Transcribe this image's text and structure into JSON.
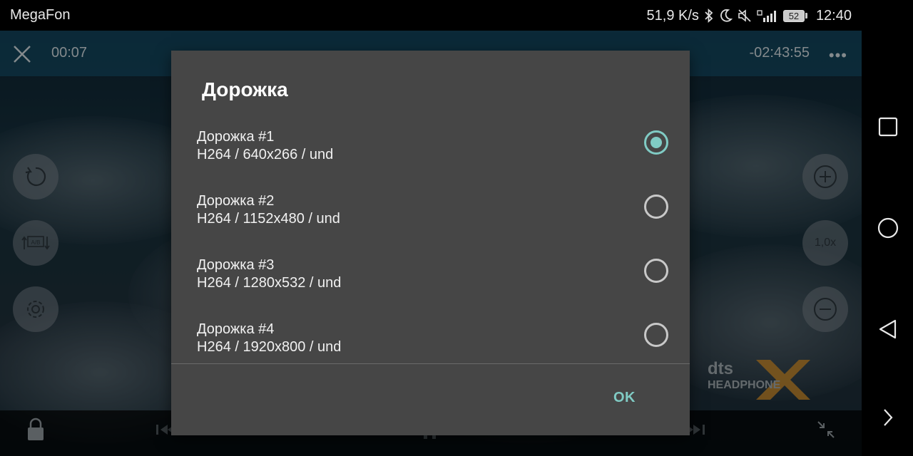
{
  "status_bar": {
    "carrier": "MegaFon",
    "speed": "51,9 K/s",
    "battery": "52",
    "time": "12:40"
  },
  "player": {
    "elapsed": "00:07",
    "remaining": "-02:43:55",
    "speed_label": "1,0x",
    "dts_brand": "dts",
    "dts_sub": "HEADPHONE"
  },
  "dialog": {
    "title": "Дорожка",
    "options": [
      {
        "name": "Дорожка #1",
        "detail": "H264 / 640x266 / und",
        "selected": true
      },
      {
        "name": "Дорожка #2",
        "detail": "H264 / 1152x480 / und",
        "selected": false
      },
      {
        "name": "Дорожка #3",
        "detail": "H264 / 1280x532 / und",
        "selected": false
      },
      {
        "name": "Дорожка #4",
        "detail": "H264 / 1920x800 / und",
        "selected": false
      }
    ],
    "ok_label": "OK",
    "accent_color": "#80cbc4"
  },
  "icons": {
    "status": [
      "bluetooth-icon",
      "moon-icon",
      "mute-icon",
      "signal-icon",
      "battery-icon"
    ],
    "player_left": [
      "rotate-icon",
      "ab-repeat-icon",
      "settings-gear-icon"
    ],
    "player_right": [
      "zoom-in-icon",
      "playback-speed-button",
      "zoom-out-icon"
    ],
    "nav": [
      "recents-square-icon",
      "home-circle-icon",
      "back-triangle-icon",
      "chevron-right-icon"
    ]
  }
}
